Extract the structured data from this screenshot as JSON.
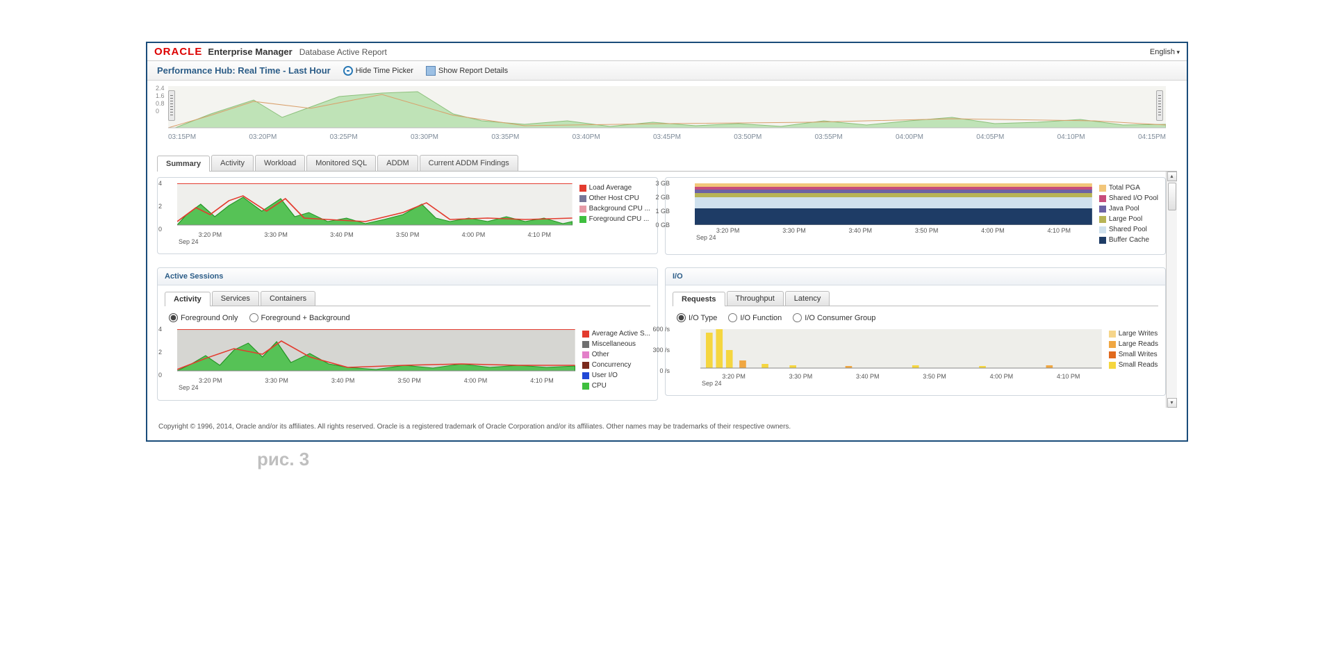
{
  "brand": {
    "logo": "ORACLE",
    "product": "Enterprise Manager",
    "subtitle": "Database Active Report"
  },
  "language": "English",
  "page_title": "Performance Hub: Real Time - Last Hour",
  "actions": {
    "hide_time_picker": "Hide Time Picker",
    "show_report_details": "Show Report Details"
  },
  "time_picker": {
    "ylabels": [
      "2.4",
      "1.6",
      "0.8",
      "0"
    ],
    "xlabels": [
      "03:15PM",
      "03:20PM",
      "03:25PM",
      "03:30PM",
      "03:35PM",
      "03:40PM",
      "03:45PM",
      "03:50PM",
      "03:55PM",
      "04:00PM",
      "04:05PM",
      "04:10PM",
      "04:15PM"
    ]
  },
  "tabs": [
    "Summary",
    "Activity",
    "Workload",
    "Monitored SQL",
    "ADDM",
    "Current ADDM Findings"
  ],
  "active_tab": 0,
  "top_charts": {
    "cpu": {
      "legend": [
        {
          "label": "Load Average",
          "color": "#e33b2e"
        },
        {
          "label": "Other Host CPU",
          "color": "#777799"
        },
        {
          "label": "Background CPU ...",
          "color": "#e59aa6"
        },
        {
          "label": "Foreground CPU ...",
          "color": "#3fbf3f"
        }
      ],
      "x": [
        "3:20 PM",
        "3:30 PM",
        "3:40 PM",
        "3:50 PM",
        "4:00 PM",
        "4:10 PM"
      ],
      "date": "Sep 24",
      "y": [
        "4",
        "2",
        "0"
      ]
    },
    "memory": {
      "legend": [
        {
          "label": "Total PGA",
          "color": "#f2c67a"
        },
        {
          "label": "Shared I/O Pool",
          "color": "#c74c7b"
        },
        {
          "label": "Java Pool",
          "color": "#6c63a5"
        },
        {
          "label": "Large Pool",
          "color": "#b7b456"
        },
        {
          "label": "Shared Pool",
          "color": "#cfe1ee"
        },
        {
          "label": "Buffer Cache",
          "color": "#1e3c66"
        }
      ],
      "x": [
        "3:20 PM",
        "3:30 PM",
        "3:40 PM",
        "3:50 PM",
        "4:00 PM",
        "4:10 PM"
      ],
      "date": "Sep 24",
      "y": [
        "3 GB",
        "2 GB",
        "1 GB",
        "0 GB"
      ]
    }
  },
  "active_sessions": {
    "title": "Active Sessions",
    "subtabs": [
      "Activity",
      "Services",
      "Containers"
    ],
    "active_subtab": 0,
    "radios": [
      "Foreground Only",
      "Foreground + Background"
    ],
    "legend": [
      {
        "label": "Average Active S...",
        "color": "#e33b2e"
      },
      {
        "label": "Miscellaneous",
        "color": "#707070"
      },
      {
        "label": "Other",
        "color": "#e37fc9"
      },
      {
        "label": "Concurrency",
        "color": "#7a2a1d"
      },
      {
        "label": "User I/O",
        "color": "#2148d6"
      },
      {
        "label": "CPU",
        "color": "#3fbf3f"
      }
    ],
    "x": [
      "3:20 PM",
      "3:30 PM",
      "3:40 PM",
      "3:50 PM",
      "4:00 PM",
      "4:10 PM"
    ],
    "date": "Sep 24",
    "y": [
      "4",
      "2",
      "0"
    ]
  },
  "io": {
    "title": "I/O",
    "subtabs": [
      "Requests",
      "Throughput",
      "Latency"
    ],
    "active_subtab": 0,
    "radios": [
      "I/O Type",
      "I/O Function",
      "I/O Consumer Group"
    ],
    "legend": [
      {
        "label": "Large Writes",
        "color": "#f6d58a"
      },
      {
        "label": "Large Reads",
        "color": "#f0a742"
      },
      {
        "label": "Small Writes",
        "color": "#e06a1e"
      },
      {
        "label": "Small Reads",
        "color": "#f5d63f"
      }
    ],
    "x": [
      "3:20 PM",
      "3:30 PM",
      "3:40 PM",
      "3:50 PM",
      "4:00 PM",
      "4:10 PM"
    ],
    "date": "Sep 24",
    "y": [
      "600  /s",
      "300  /s",
      "0  /s"
    ]
  },
  "footer": "Copyright © 1996, 2014, Oracle and/or its affiliates. All rights reserved. Oracle is a registered trademark of Oracle Corporation and/or its affiliates. Other names may be trademarks of their respective owners.",
  "caption": "рис. 3",
  "chart_data": [
    {
      "type": "area",
      "title": "Time Picker Overview",
      "x": [
        "03:15PM",
        "03:20PM",
        "03:25PM",
        "03:30PM",
        "03:35PM",
        "03:40PM",
        "03:45PM",
        "03:50PM",
        "03:55PM",
        "04:00PM",
        "04:05PM",
        "04:10PM",
        "04:15PM"
      ],
      "values": [
        0,
        1.0,
        1.8,
        1.2,
        2.2,
        2.4,
        0.8,
        0.5,
        0.6,
        0.4,
        0.5,
        0.4,
        0.7,
        0.6
      ],
      "ylim": [
        0,
        2.4
      ]
    },
    {
      "type": "area",
      "title": "CPU / Load Average",
      "x": [
        "3:20 PM",
        "3:30 PM",
        "3:40 PM",
        "3:50 PM",
        "4:00 PM",
        "4:10 PM"
      ],
      "series": [
        {
          "name": "Load Average",
          "values": [
            1.2,
            2.1,
            1.4,
            0.8,
            1.6,
            1.0
          ]
        },
        {
          "name": "Foreground CPU",
          "values": [
            0.8,
            1.6,
            0.9,
            0.5,
            1.0,
            0.6
          ]
        }
      ],
      "ylim": [
        0,
        4
      ]
    },
    {
      "type": "area",
      "title": "Memory Pools",
      "x": [
        "3:20 PM",
        "3:30 PM",
        "3:40 PM",
        "3:50 PM",
        "4:00 PM",
        "4:10 PM"
      ],
      "series": [
        {
          "name": "Buffer Cache",
          "values": [
            1.2,
            1.2,
            1.2,
            1.2,
            1.2,
            1.2
          ]
        },
        {
          "name": "Shared Pool",
          "values": [
            0.9,
            0.9,
            0.9,
            0.9,
            0.9,
            0.9
          ]
        },
        {
          "name": "Large Pool",
          "values": [
            0.3,
            0.3,
            0.3,
            0.3,
            0.3,
            0.3
          ]
        },
        {
          "name": "Java Pool",
          "values": [
            0.2,
            0.2,
            0.2,
            0.2,
            0.2,
            0.2
          ]
        },
        {
          "name": "Shared I/O Pool",
          "values": [
            0.2,
            0.2,
            0.2,
            0.2,
            0.2,
            0.2
          ]
        },
        {
          "name": "Total PGA",
          "values": [
            0.2,
            0.2,
            0.2,
            0.2,
            0.2,
            0.2
          ]
        }
      ],
      "ylim": [
        0,
        3
      ],
      "ylabel": "GB"
    },
    {
      "type": "area",
      "title": "Active Sessions",
      "x": [
        "3:20 PM",
        "3:30 PM",
        "3:40 PM",
        "3:50 PM",
        "4:00 PM",
        "4:10 PM"
      ],
      "series": [
        {
          "name": "CPU",
          "values": [
            0.7,
            1.8,
            0.8,
            0.5,
            0.9,
            0.5
          ]
        },
        {
          "name": "Average Active Sessions",
          "values": [
            1.0,
            2.2,
            1.1,
            0.7,
            1.2,
            0.8
          ]
        }
      ],
      "ylim": [
        0,
        4
      ]
    },
    {
      "type": "bar",
      "title": "I/O Requests",
      "x": [
        "3:20 PM",
        "3:30 PM",
        "3:40 PM",
        "3:50 PM",
        "4:00 PM",
        "4:10 PM"
      ],
      "values": [
        700,
        120,
        60,
        50,
        40,
        50
      ],
      "ylabel": "/s",
      "ylim": [
        0,
        700
      ]
    }
  ]
}
